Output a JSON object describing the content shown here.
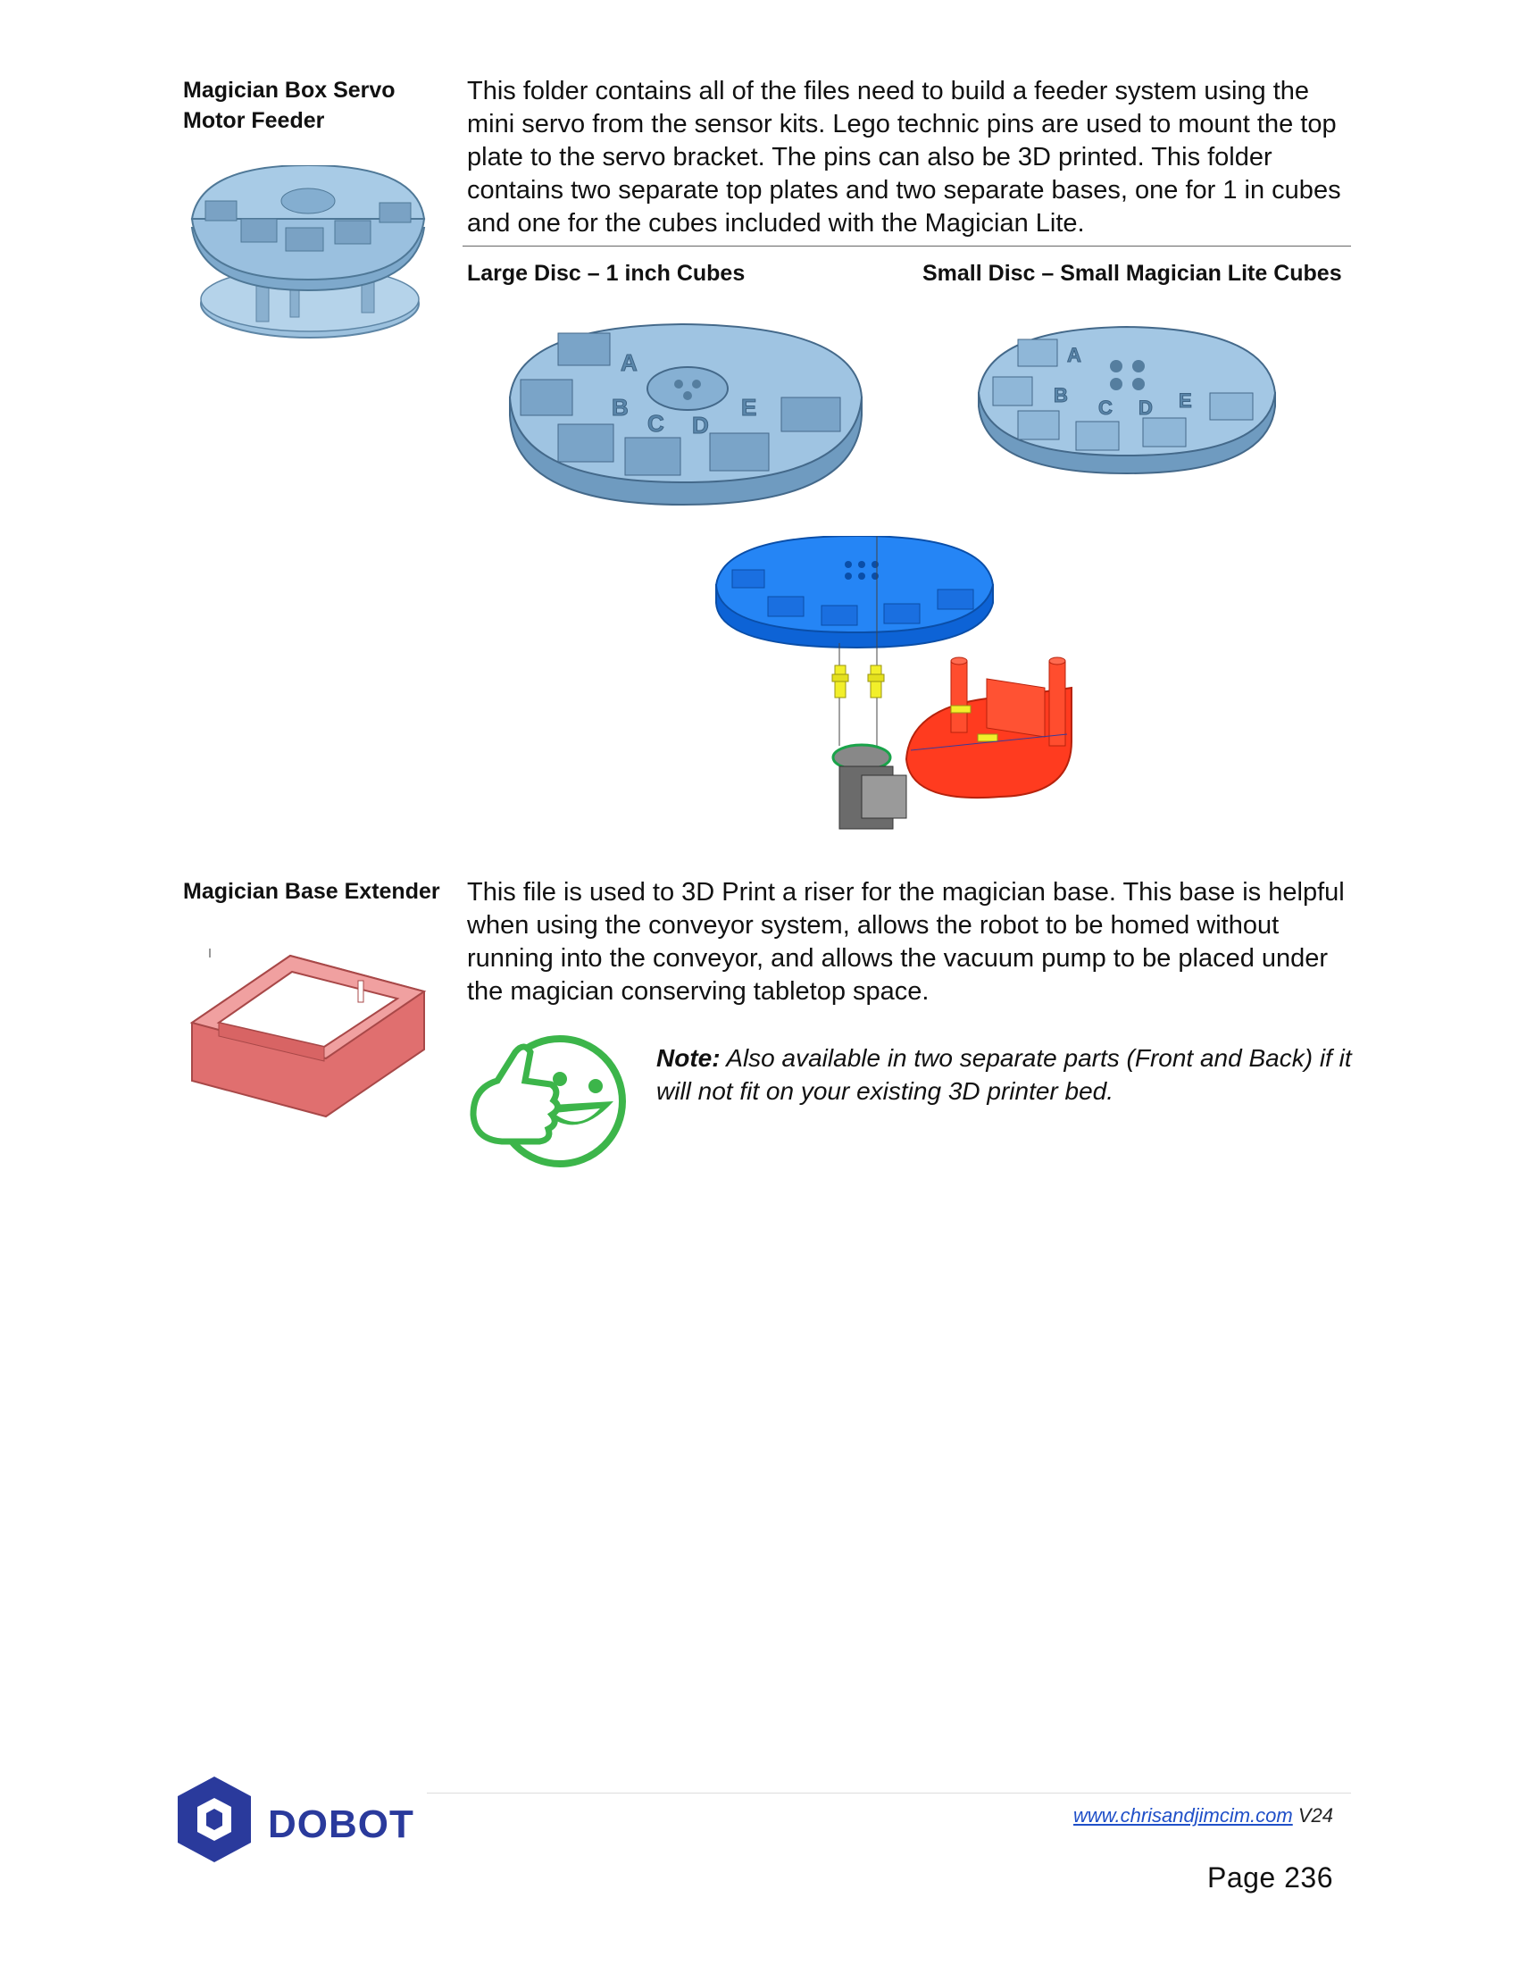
{
  "section1": {
    "title_line1": "Magician Box Servo",
    "title_line2": "Motor Feeder",
    "description": "This folder contains all of the files need to build a feeder system using the mini servo from the sensor kits.  Lego technic pins are used to mount the top plate to the servo bracket.  The pins can also be 3D printed.  This folder contains two separate top plates and two separate bases, one for 1 in cubes and one for the cubes included with the Magician Lite.",
    "col_left_heading": "Large Disc – 1 inch Cubes",
    "col_right_heading": "Small Disc – Small Magician Lite Cubes",
    "disc_letters": [
      "A",
      "B",
      "C",
      "D",
      "E"
    ]
  },
  "section2": {
    "title": "Magician Base Extender",
    "description": "This file is used to 3D Print a riser for the magician base.  This base is helpful when using the conveyor system, allows the robot to be homed without running into the conveyor, and allows the vacuum pump to be placed under the magician conserving tabletop space.",
    "note_label": "Note:",
    "note_text": " Also available in two separate parts (Front and Back) if it will not fit on your existing 3D printer bed."
  },
  "footer": {
    "logo_text": "DOBOT",
    "url": "www.chrisandjimcim.com",
    "version": " V24",
    "page_label": "Page 236"
  },
  "colors": {
    "disc_blue": "#8fb8d8",
    "assembly_blue": "#1e7ef0",
    "assembly_red": "#ff3b1f",
    "extender_red": "#e88a8a",
    "smiley_green": "#3cb54a",
    "logo_navy": "#2a3a9c"
  }
}
